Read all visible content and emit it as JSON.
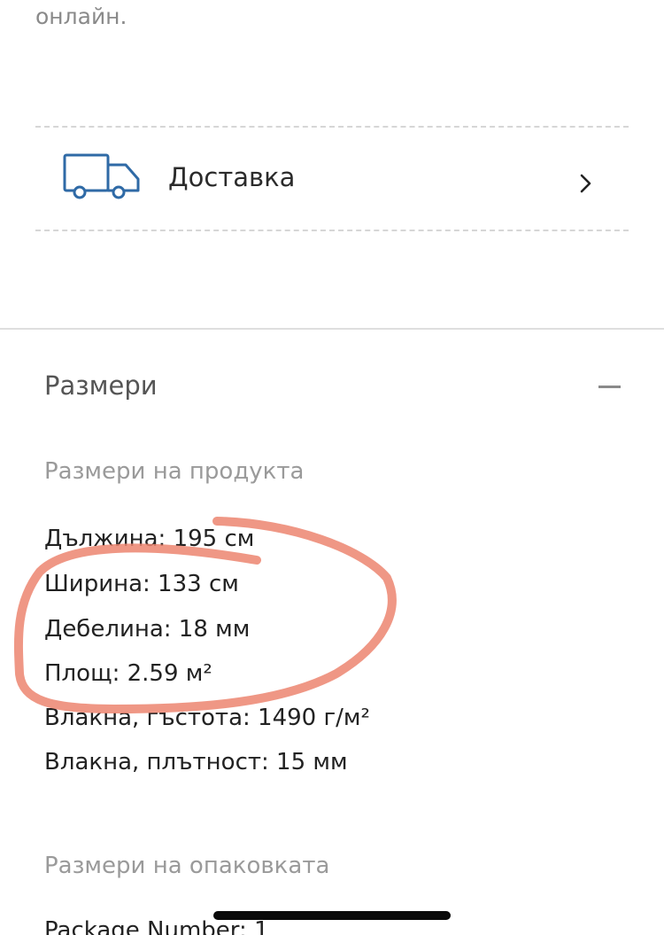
{
  "intro": {
    "text_tail": "онлайн."
  },
  "delivery": {
    "label": "Доставка",
    "icon": "truck-icon",
    "arrow_icon": "chevron-right-icon"
  },
  "dimensions_section": {
    "title": "Размери",
    "toggle_icon": "minus-icon",
    "product": {
      "heading": "Размери на продукта",
      "specs": [
        {
          "label": "Дължина: 195 см"
        },
        {
          "label": "Ширина: 133 см"
        },
        {
          "label": "Дебелина: 18 мм"
        },
        {
          "label": "Площ: 2.59 м²"
        },
        {
          "label": "Влакна, гъстота: 1490 г/м²"
        },
        {
          "label": "Влакна, плътност: 15 мм"
        }
      ]
    },
    "package": {
      "heading": "Размери на опаковката",
      "specs": [
        {
          "label": "Package Number: 1"
        }
      ]
    }
  },
  "colors": {
    "icon_blue": "#2f6aa6",
    "annotation": "#ec8570",
    "muted_text": "#9a9a9a",
    "dashed_border": "#d6d6d6"
  }
}
